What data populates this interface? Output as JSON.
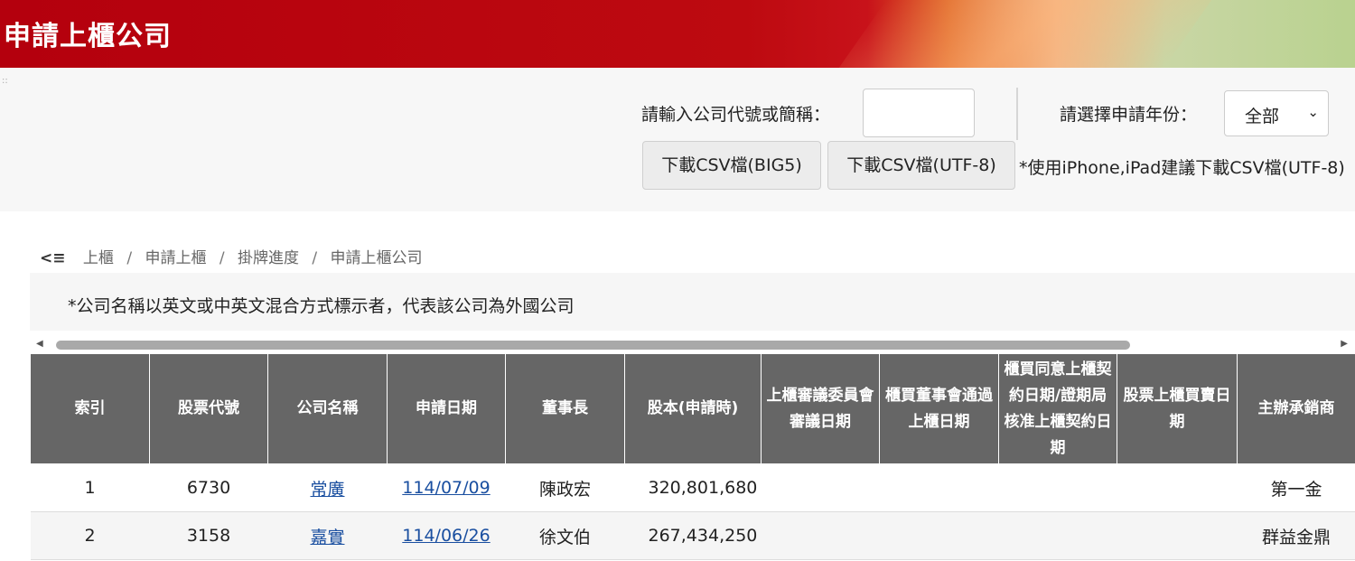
{
  "header": {
    "title": "申請上櫃公司"
  },
  "controls": {
    "search_label": "請輸入公司代號或簡稱：",
    "search_value": "",
    "year_label": "請選擇申請年份：",
    "year_value": "全部",
    "download_big5": "下載CSV檔(BIG5)",
    "download_utf8": "下載CSV檔(UTF-8)",
    "download_note": "*使用iPhone,iPad建議下載CSV檔(UTF-8)"
  },
  "breadcrumb": {
    "back_icon": "◀≡",
    "items": [
      "上櫃",
      "申請上櫃",
      "掛牌進度",
      "申請上櫃公司"
    ]
  },
  "notice": "*公司名稱以英文或中英文混合方式標示者，代表該公司為外國公司",
  "table": {
    "headers": [
      "索引",
      "股票代號",
      "公司名稱",
      "申請日期",
      "董事長",
      "股本(申請時)",
      "上櫃審議委員會審議日期",
      "櫃買董事會通過上櫃日期",
      "櫃買同意上櫃契約日期/證期局核准上櫃契約日期",
      "股票上櫃買賣日期",
      "主辦承銷商"
    ],
    "rows": [
      [
        "1",
        "6730",
        "常廣",
        "114/07/09",
        "陳政宏",
        "320,801,680",
        "",
        "",
        "",
        "",
        "第一金"
      ],
      [
        "2",
        "3158",
        "嘉實",
        "114/06/26",
        "徐文伯",
        "267,434,250",
        "",
        "",
        "",
        "",
        "群益金鼎"
      ]
    ]
  },
  "colors": {
    "banner": "#b4000d",
    "table_header": "#666666",
    "link": "#1a4fa0"
  }
}
